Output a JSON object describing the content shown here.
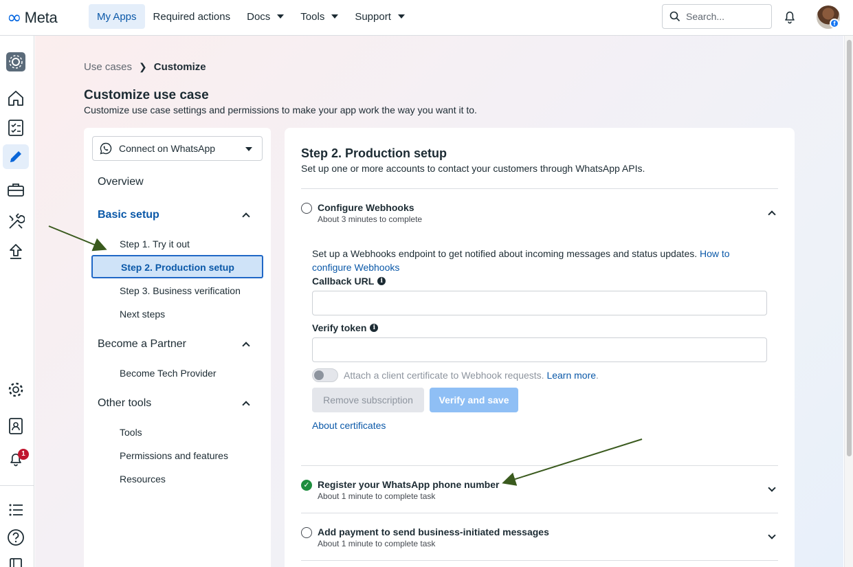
{
  "header": {
    "logo_text": "Meta",
    "nav": [
      {
        "label": "My Apps",
        "active": true
      },
      {
        "label": "Required actions"
      },
      {
        "label": "Docs"
      },
      {
        "label": "Tools"
      },
      {
        "label": "Support"
      }
    ],
    "search_placeholder": "Search..."
  },
  "rail": {
    "notification_count": "1"
  },
  "breadcrumb": {
    "parent": "Use cases",
    "current": "Customize"
  },
  "page": {
    "title": "Customize use case",
    "subtitle": "Customize use case settings and permissions to make your app work the way you want it to."
  },
  "side": {
    "use_case": "Connect on WhatsApp",
    "overview": "Overview",
    "basic_setup": {
      "label": "Basic setup",
      "items": [
        "Step 1. Try it out",
        "Step 2. Production setup",
        "Step 3. Business verification",
        "Next steps"
      ]
    },
    "partner": {
      "label": "Become a Partner",
      "items": [
        "Become Tech Provider"
      ]
    },
    "other": {
      "label": "Other tools",
      "items": [
        "Tools",
        "Permissions and features",
        "Resources"
      ]
    }
  },
  "content": {
    "title": "Step 2. Production setup",
    "subtitle": "Set up one or more accounts to contact your customers through WhatsApp APIs.",
    "webhooks": {
      "title": "Configure Webhooks",
      "subtitle": "About 3 minutes to complete",
      "description": "Set up a Webhooks endpoint to get notified about incoming messages and status updates.",
      "description_link": "How to configure Webhooks",
      "callback_label": "Callback URL",
      "callback_value": "",
      "verify_label": "Verify token",
      "verify_value": "",
      "certificate_toggle_label": "Attach a client certificate to Webhook requests.",
      "learn_more": "Learn more",
      "learn_more_suffix": ".",
      "remove_button": "Remove subscription",
      "verify_button": "Verify and save",
      "about_certificates": "About certificates"
    },
    "tasks": [
      {
        "title": "Register your WhatsApp phone number",
        "subtitle": "About 1 minute to complete task",
        "status": "complete"
      },
      {
        "title": "Add payment to send business-initiated messages",
        "subtitle": "About 1 minute to complete task",
        "status": "incomplete"
      }
    ]
  },
  "colors": {
    "accent": "#0a58a8",
    "active_bg": "#cfe3f8",
    "complete": "#1e8e3e",
    "annotation_arrow": "#3a5a1e"
  }
}
